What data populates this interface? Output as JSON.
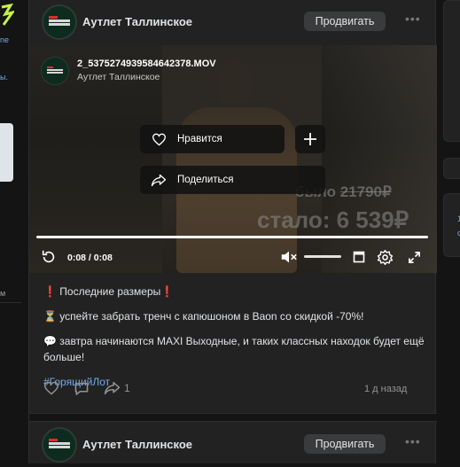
{
  "left_sidebar": {
    "fragments": [
      "ne",
      "ы.",
      "м",
      "ы"
    ]
  },
  "post": {
    "author": "Аутлет Таллинское",
    "promote_label": "Продвигать",
    "more_icon": "more-horizontal-icon",
    "video": {
      "filename": "2_5375274939584642378.MOV",
      "author": "Аутлет Таллинское",
      "like_label": "Нравится",
      "share_label": "Поделиться",
      "time": "0:08 / 0:08",
      "price_old_prefix": "было ",
      "price_old": "21790₽",
      "price_new": "стало: 6 539₽",
      "progress": 1.0
    },
    "text": {
      "line1": "❗ Последние размеры❗",
      "line2": "⏳ успейте забрать тренч с капюшоном в Baon со скидкой -70%!",
      "line3": "💬 завтра начинаются MAXI Выходные, и таких классных находок будет ещё больше!",
      "hashtag": "#ГорящийЛот"
    },
    "shares_count": "1",
    "date": "1 д назад"
  },
  "next_post": {
    "author": "Аутлет Таллинское",
    "promote_label": "Продвигать"
  },
  "right_sidebar": {
    "fragments": [
      "1",
      "с"
    ]
  },
  "colors": {
    "background": "#141414",
    "card": "#222222",
    "accent_link": "#71aaeb",
    "secondary_text": "#939393"
  }
}
